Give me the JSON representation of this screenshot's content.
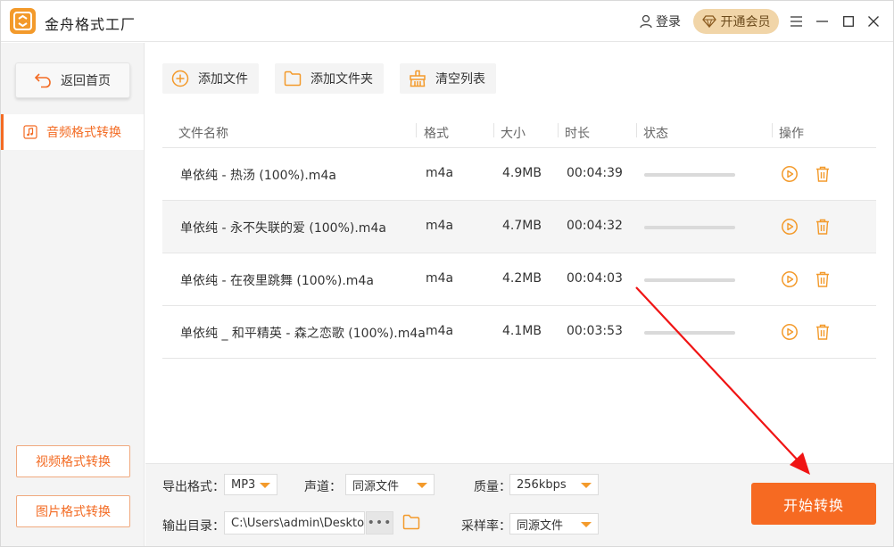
{
  "app": {
    "title": "金舟格式工厂",
    "accent": "#f36b23",
    "logo_color": "#f39a2b"
  },
  "titlebar": {
    "login_label": "登录",
    "vip_label": "开通会员"
  },
  "sidebar": {
    "back_label": "返回首页",
    "active_item": "音频格式转换",
    "video_button": "视频格式转换",
    "image_button": "图片格式转换"
  },
  "toolbar": {
    "add_file": "添加文件",
    "add_folder": "添加文件夹",
    "clear_list": "清空列表"
  },
  "table": {
    "headers": {
      "name": "文件名称",
      "format": "格式",
      "size": "大小",
      "duration": "时长",
      "status": "状态",
      "action": "操作"
    },
    "rows": [
      {
        "name": "单依纯 - 热汤 (100%).m4a",
        "format": "m4a",
        "size": "4.9MB",
        "duration": "00:04:39"
      },
      {
        "name": "单依纯 - 永不失联的爱 (100%).m4a",
        "format": "m4a",
        "size": "4.7MB",
        "duration": "00:04:32"
      },
      {
        "name": "单依纯 - 在夜里跳舞 (100%).m4a",
        "format": "m4a",
        "size": "4.2MB",
        "duration": "00:04:03"
      },
      {
        "name": "单依纯 _ 和平精英 - 森之恋歌 (100%).m4a",
        "format": "m4a",
        "size": "4.1MB",
        "duration": "00:03:53"
      }
    ]
  },
  "settings": {
    "export_format_label": "导出格式：",
    "export_format_value": "MP3",
    "channel_label": "声道：",
    "channel_value": "同源文件",
    "quality_label": "质量：",
    "quality_value": "256kbps",
    "output_dir_label": "输出目录：",
    "output_dir_value": "C:\\Users\\admin\\Desktop\\",
    "browse_label": "•••",
    "sample_rate_label": "采样率：",
    "sample_rate_value": "同源文件"
  },
  "start_button": "开始转换"
}
